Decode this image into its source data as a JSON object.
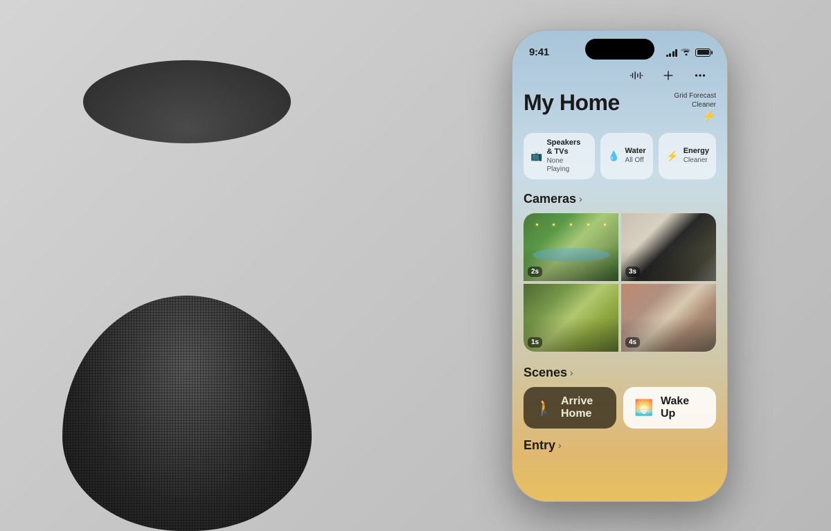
{
  "background": {
    "color": "#d4d0cc"
  },
  "statusBar": {
    "time": "9:41",
    "signalBars": [
      3,
      5,
      7,
      9,
      11
    ],
    "batteryPercent": 100
  },
  "topActions": [
    {
      "name": "waveform-button",
      "icon": "waveform"
    },
    {
      "name": "add-button",
      "icon": "plus"
    },
    {
      "name": "more-button",
      "icon": "ellipsis"
    }
  ],
  "header": {
    "title": "My Home",
    "gridForecast": {
      "line1": "Grid Forecast",
      "line2": "Cleaner",
      "icon": "⚡"
    }
  },
  "chips": [
    {
      "icon": "📺",
      "label": "Speakers & TVs",
      "sublabel": "None Playing"
    },
    {
      "icon": "💧",
      "label": "Water",
      "sublabel": "All Off"
    },
    {
      "icon": "⚡",
      "label": "Energy",
      "sublabel": "Cleaner"
    }
  ],
  "cameras": {
    "sectionTitle": "Cameras",
    "items": [
      {
        "id": "cam1",
        "timer": "2s"
      },
      {
        "id": "cam2",
        "timer": "3s"
      },
      {
        "id": "cam3",
        "timer": "1s"
      },
      {
        "id": "cam4",
        "timer": "4s"
      }
    ]
  },
  "scenes": {
    "sectionTitle": "Scenes",
    "items": [
      {
        "label": "Arrive Home",
        "icon": "🚶",
        "style": "dark"
      },
      {
        "label": "Wake Up",
        "icon": "🌅",
        "style": "light"
      }
    ]
  },
  "entry": {
    "sectionTitle": "Entry"
  }
}
